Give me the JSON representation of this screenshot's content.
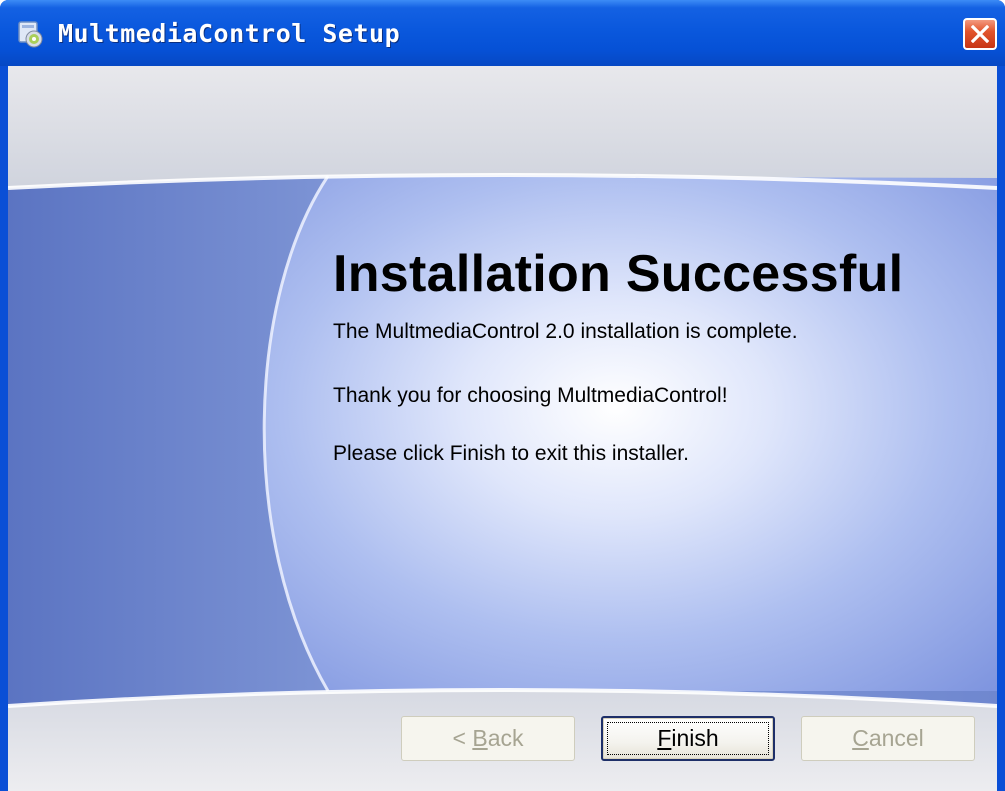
{
  "window": {
    "title": "MultmediaControl Setup",
    "icon": "installer-disc-icon",
    "close_icon": "close-icon"
  },
  "page": {
    "heading": "Installation Successful",
    "paragraphs": [
      "The MultmediaControl 2.0 installation is complete.",
      "Thank you for choosing MultmediaControl!",
      "Please click Finish to exit this installer."
    ]
  },
  "buttons": {
    "back": {
      "prefix": "< ",
      "mnemonic": "B",
      "rest": "ack",
      "enabled": false
    },
    "finish": {
      "prefix": "",
      "mnemonic": "F",
      "rest": "inish",
      "enabled": true,
      "default": true
    },
    "cancel": {
      "prefix": "",
      "mnemonic": "C",
      "rest": "ancel",
      "enabled": false
    }
  },
  "colors": {
    "titlebar": "#0a58dd",
    "close_button": "#e2552d",
    "dialog_face": "#ece9d8",
    "banner_blue": "#8fa5e8"
  }
}
